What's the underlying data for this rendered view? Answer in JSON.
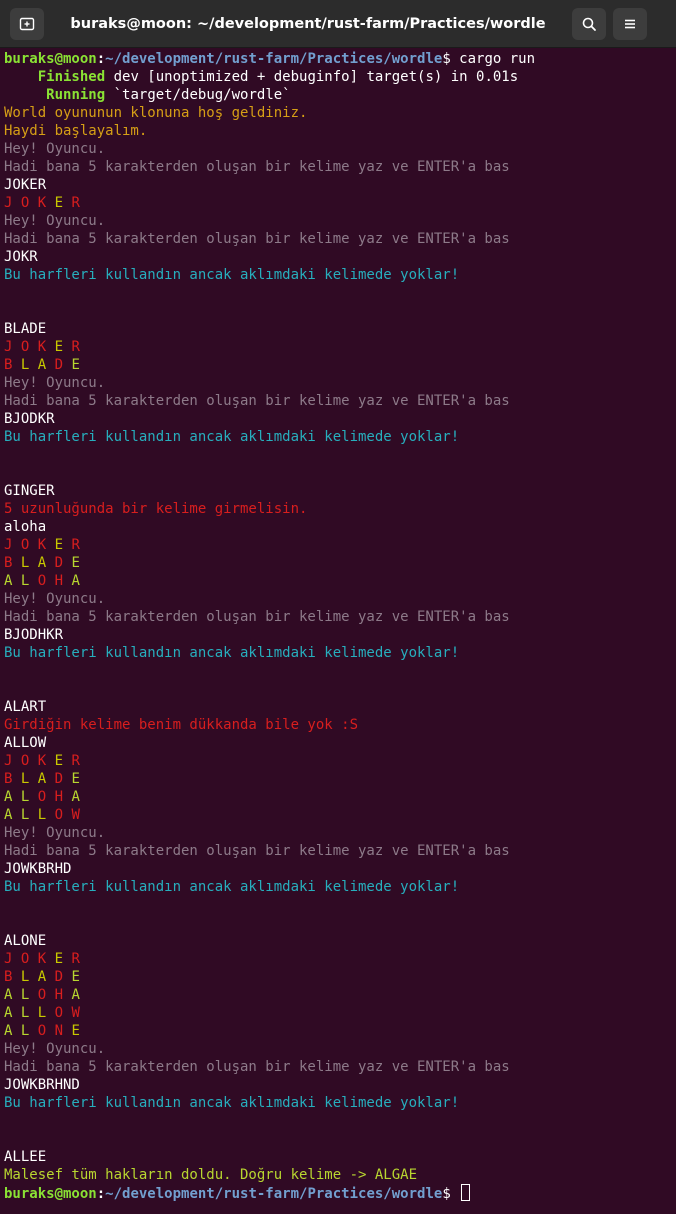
{
  "window": {
    "title": "buraks@moon: ~/development/rust-farm/Practices/wordle",
    "new_tab_icon": "new-tab-icon",
    "search_icon": "search-icon",
    "menu_icon": "hamburger-menu-icon"
  },
  "colors": {
    "background": "#300a24",
    "prompt_user": "#8ae234",
    "prompt_path": "#729fcf",
    "letter_absent": "#d81e1e",
    "letter_present": "#c8c800",
    "letter_correct": "#8ae234",
    "info_gray": "#8d7a89",
    "feedback_teal": "#27aebd",
    "welcome_orange": "#d69f16"
  },
  "terminal": {
    "lines": [
      {
        "type": "prompt",
        "user": "buraks@moon",
        "sep": ":",
        "path": "~/development/rust-farm/Practices/wordle",
        "end": "$ ",
        "cmd": "cargo run"
      },
      {
        "type": "segs",
        "segs": [
          [
            "    ",
            ""
          ],
          [
            "Finished",
            "c-green"
          ],
          [
            " dev [unoptimized + debuginfo] target(s) in 0.01s",
            "c-white"
          ]
        ]
      },
      {
        "type": "segs",
        "segs": [
          [
            "     ",
            ""
          ],
          [
            "Running",
            "c-green"
          ],
          [
            " `target/debug/wordle`",
            "c-white"
          ]
        ]
      },
      {
        "type": "text",
        "cls": "c-orange",
        "text": "World oyununun klonuna hoş geldiniz."
      },
      {
        "type": "text",
        "cls": "c-orange",
        "text": "Haydi başlayalım."
      },
      {
        "type": "text",
        "cls": "c-gray",
        "text": "Hey! Oyuncu."
      },
      {
        "type": "text",
        "cls": "c-gray",
        "text": "Hadi bana 5 karakterden oluşan bir kelime yaz ve ENTER'a bas"
      },
      {
        "type": "text",
        "cls": "c-white",
        "text": "JOKER"
      },
      {
        "type": "letters",
        "letters": [
          [
            "J",
            "r"
          ],
          [
            "O",
            "r"
          ],
          [
            "K",
            "r"
          ],
          [
            "E",
            "y"
          ],
          [
            "R",
            "r"
          ]
        ]
      },
      {
        "type": "text",
        "cls": "c-gray",
        "text": "Hey! Oyuncu."
      },
      {
        "type": "text",
        "cls": "c-gray",
        "text": "Hadi bana 5 karakterden oluşan bir kelime yaz ve ENTER'a bas"
      },
      {
        "type": "text",
        "cls": "c-white",
        "text": "JOKR"
      },
      {
        "type": "text",
        "cls": "c-teal",
        "text": "Bu harfleri kullandın ancak aklımdaki kelimede yoklar!"
      },
      {
        "type": "blank"
      },
      {
        "type": "blank"
      },
      {
        "type": "text",
        "cls": "c-white",
        "text": "BLADE"
      },
      {
        "type": "letters",
        "letters": [
          [
            "J",
            "r"
          ],
          [
            "O",
            "r"
          ],
          [
            "K",
            "r"
          ],
          [
            "E",
            "y"
          ],
          [
            "R",
            "r"
          ]
        ]
      },
      {
        "type": "letters",
        "letters": [
          [
            "B",
            "r"
          ],
          [
            "L",
            "y"
          ],
          [
            "A",
            "y"
          ],
          [
            "D",
            "r"
          ],
          [
            "E",
            "g"
          ]
        ]
      },
      {
        "type": "text",
        "cls": "c-gray",
        "text": "Hey! Oyuncu."
      },
      {
        "type": "text",
        "cls": "c-gray",
        "text": "Hadi bana 5 karakterden oluşan bir kelime yaz ve ENTER'a bas"
      },
      {
        "type": "text",
        "cls": "c-white",
        "text": "BJODKR"
      },
      {
        "type": "text",
        "cls": "c-teal",
        "text": "Bu harfleri kullandın ancak aklımdaki kelimede yoklar!"
      },
      {
        "type": "blank"
      },
      {
        "type": "blank"
      },
      {
        "type": "text",
        "cls": "c-white",
        "text": "GINGER"
      },
      {
        "type": "text",
        "cls": "c-red",
        "text": "5 uzunluğunda bir kelime girmelisin."
      },
      {
        "type": "text",
        "cls": "c-white",
        "text": "aloha"
      },
      {
        "type": "letters",
        "letters": [
          [
            "J",
            "r"
          ],
          [
            "O",
            "r"
          ],
          [
            "K",
            "r"
          ],
          [
            "E",
            "y"
          ],
          [
            "R",
            "r"
          ]
        ]
      },
      {
        "type": "letters",
        "letters": [
          [
            "B",
            "r"
          ],
          [
            "L",
            "y"
          ],
          [
            "A",
            "y"
          ],
          [
            "D",
            "r"
          ],
          [
            "E",
            "g"
          ]
        ]
      },
      {
        "type": "letters",
        "letters": [
          [
            "A",
            "g"
          ],
          [
            "L",
            "g"
          ],
          [
            "O",
            "r"
          ],
          [
            "H",
            "r"
          ],
          [
            "A",
            "g"
          ]
        ]
      },
      {
        "type": "text",
        "cls": "c-gray",
        "text": "Hey! Oyuncu."
      },
      {
        "type": "text",
        "cls": "c-gray",
        "text": "Hadi bana 5 karakterden oluşan bir kelime yaz ve ENTER'a bas"
      },
      {
        "type": "text",
        "cls": "c-white",
        "text": "BJODHKR"
      },
      {
        "type": "text",
        "cls": "c-teal",
        "text": "Bu harfleri kullandın ancak aklımdaki kelimede yoklar!"
      },
      {
        "type": "blank"
      },
      {
        "type": "blank"
      },
      {
        "type": "text",
        "cls": "c-white",
        "text": "ALART"
      },
      {
        "type": "text",
        "cls": "c-red",
        "text": "Girdiğin kelime benim dükkanda bile yok :S"
      },
      {
        "type": "text",
        "cls": "c-white",
        "text": "ALLOW"
      },
      {
        "type": "letters",
        "letters": [
          [
            "J",
            "r"
          ],
          [
            "O",
            "r"
          ],
          [
            "K",
            "r"
          ],
          [
            "E",
            "y"
          ],
          [
            "R",
            "r"
          ]
        ]
      },
      {
        "type": "letters",
        "letters": [
          [
            "B",
            "r"
          ],
          [
            "L",
            "y"
          ],
          [
            "A",
            "y"
          ],
          [
            "D",
            "r"
          ],
          [
            "E",
            "g"
          ]
        ]
      },
      {
        "type": "letters",
        "letters": [
          [
            "A",
            "g"
          ],
          [
            "L",
            "g"
          ],
          [
            "O",
            "r"
          ],
          [
            "H",
            "r"
          ],
          [
            "A",
            "g"
          ]
        ]
      },
      {
        "type": "letters",
        "letters": [
          [
            "A",
            "g"
          ],
          [
            "L",
            "g"
          ],
          [
            "L",
            "y"
          ],
          [
            "O",
            "r"
          ],
          [
            "W",
            "r"
          ]
        ]
      },
      {
        "type": "text",
        "cls": "c-gray",
        "text": "Hey! Oyuncu."
      },
      {
        "type": "text",
        "cls": "c-gray",
        "text": "Hadi bana 5 karakterden oluşan bir kelime yaz ve ENTER'a bas"
      },
      {
        "type": "text",
        "cls": "c-white",
        "text": "JOWKBRHD"
      },
      {
        "type": "text",
        "cls": "c-teal",
        "text": "Bu harfleri kullandın ancak aklımdaki kelimede yoklar!"
      },
      {
        "type": "blank"
      },
      {
        "type": "blank"
      },
      {
        "type": "text",
        "cls": "c-white",
        "text": "ALONE"
      },
      {
        "type": "letters",
        "letters": [
          [
            "J",
            "r"
          ],
          [
            "O",
            "r"
          ],
          [
            "K",
            "r"
          ],
          [
            "E",
            "y"
          ],
          [
            "R",
            "r"
          ]
        ]
      },
      {
        "type": "letters",
        "letters": [
          [
            "B",
            "r"
          ],
          [
            "L",
            "y"
          ],
          [
            "A",
            "y"
          ],
          [
            "D",
            "r"
          ],
          [
            "E",
            "g"
          ]
        ]
      },
      {
        "type": "letters",
        "letters": [
          [
            "A",
            "g"
          ],
          [
            "L",
            "g"
          ],
          [
            "O",
            "r"
          ],
          [
            "H",
            "r"
          ],
          [
            "A",
            "g"
          ]
        ]
      },
      {
        "type": "letters",
        "letters": [
          [
            "A",
            "g"
          ],
          [
            "L",
            "g"
          ],
          [
            "L",
            "y"
          ],
          [
            "O",
            "r"
          ],
          [
            "W",
            "r"
          ]
        ]
      },
      {
        "type": "letters",
        "letters": [
          [
            "A",
            "g"
          ],
          [
            "L",
            "g"
          ],
          [
            "O",
            "r"
          ],
          [
            "N",
            "r"
          ],
          [
            "E",
            "y"
          ]
        ]
      },
      {
        "type": "text",
        "cls": "c-gray",
        "text": "Hey! Oyuncu."
      },
      {
        "type": "text",
        "cls": "c-gray",
        "text": "Hadi bana 5 karakterden oluşan bir kelime yaz ve ENTER'a bas"
      },
      {
        "type": "text",
        "cls": "c-white",
        "text": "JOWKBRHND"
      },
      {
        "type": "text",
        "cls": "c-teal",
        "text": "Bu harfleri kullandın ancak aklımdaki kelimede yoklar!"
      },
      {
        "type": "blank"
      },
      {
        "type": "blank"
      },
      {
        "type": "text",
        "cls": "c-white",
        "text": "ALLEE"
      },
      {
        "type": "text",
        "cls": "c-lime",
        "text": "Malesef tüm hakların doldu. Doğru kelime -> ALGAE"
      },
      {
        "type": "prompt",
        "user": "buraks@moon",
        "sep": ":",
        "path": "~/development/rust-farm/Practices/wordle",
        "end": "$ ",
        "cmd": "",
        "cursor": true
      }
    ]
  }
}
